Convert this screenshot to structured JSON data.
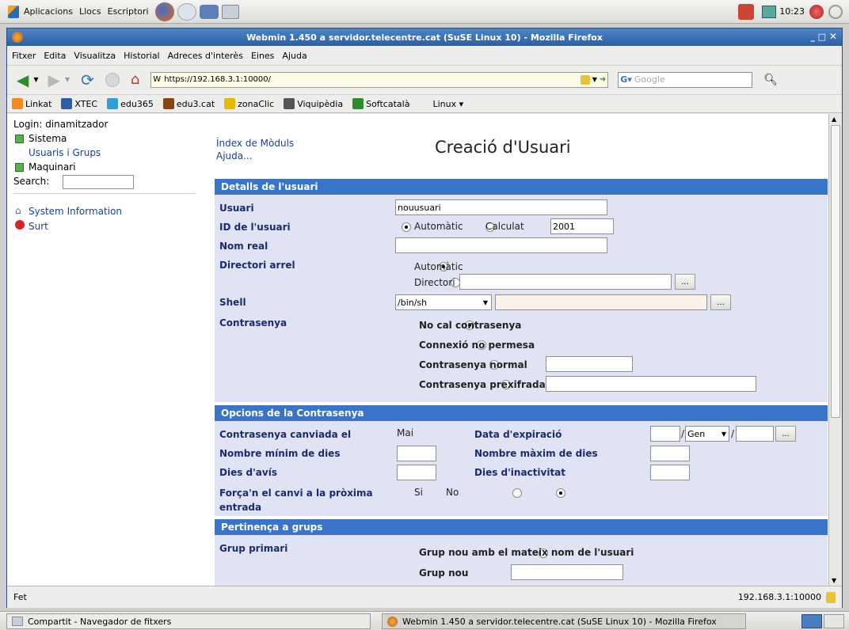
{
  "panel": {
    "menus": [
      "Aplicacions",
      "Llocs",
      "Escriptori"
    ],
    "clock": "10:23"
  },
  "window": {
    "title": "Webmin 1.450 a servidor.telecentre.cat (SuSE Linux 10) - Mozilla Firefox"
  },
  "menubar": [
    "Fitxer",
    "Edita",
    "Visualitza",
    "Historial",
    "Adreces d'interès",
    "Eines",
    "Ajuda"
  ],
  "navbar": {
    "url": "https://192.168.3.1:10000/",
    "search_placeholder": "Google"
  },
  "bookmarks": [
    {
      "label": "Linkat",
      "color": "#f28c1a"
    },
    {
      "label": "XTEC",
      "color": "#2d5fa8"
    },
    {
      "label": "edu365",
      "color": "#2f9fd8"
    },
    {
      "label": "edu3.cat",
      "color": "#8b4513"
    },
    {
      "label": "zonaClic",
      "color": "#e6b800"
    },
    {
      "label": "Viquipèdia",
      "color": "#555555"
    },
    {
      "label": "Softcatalà",
      "color": "#2e8b2e"
    },
    {
      "label": "Linux ▾",
      "color": "#ededeb"
    }
  ],
  "sidebar": {
    "login": "Login: dinamitzador",
    "sistema": "Sistema",
    "usuaris": "Usuaris i Grups",
    "maquinari": "Maquinari",
    "search": "Search:",
    "sysinfo": "System Information",
    "surt": "Surt"
  },
  "page": {
    "index_link": "Índex de Mòduls",
    "help_link": "Ajuda...",
    "title": "Creació d'Usuari"
  },
  "details": {
    "header": "Detalls de l'usuari",
    "usuari_label": "Usuari",
    "usuari_value": "nouusuari",
    "id_label": "ID de l'usuari",
    "id_auto": "Automàtic",
    "id_calc": "Calculat",
    "id_value": "2001",
    "nom_label": "Nom real",
    "dir_label": "Directori arrel",
    "dir_auto": "Automàtic",
    "dir_dir": "Directori",
    "shell_label": "Shell",
    "shell_value": "/bin/sh",
    "pass_label": "Contrasenya",
    "pass_opts": [
      "No cal contrasenya",
      "Connexió no permesa",
      "Contrasenya normal",
      "Contrasenya prexifrada"
    ]
  },
  "options": {
    "header": "Opcions de la Contrasenya",
    "changed_label": "Contrasenya canviada el",
    "changed_value": "Mai",
    "expiry_label": "Data d'expiració",
    "expiry_month": "Gen",
    "min_label": "Nombre mínim de dies",
    "max_label": "Nombre màxim de dies",
    "warn_label": "Dies d'avís",
    "inactive_label": "Dies d'inactivitat",
    "force_label": "Força'n el canvi a la pròxima entrada",
    "force_yes": "Si",
    "force_no": "No"
  },
  "groups": {
    "header": "Pertinença a grups",
    "primary_label": "Grup primari",
    "opt_same": "Grup nou amb el mateix nom de l'usuari",
    "opt_new": "Grup nou"
  },
  "browse": "...",
  "status": {
    "left": "Fet",
    "right": "192.168.3.1:10000"
  },
  "taskbar": {
    "files": "Compartit - Navegador de fitxers",
    "firefox": "Webmin 1.450 a servidor.telecentre.cat (SuSE Linux 10) - Mozilla Firefox"
  }
}
